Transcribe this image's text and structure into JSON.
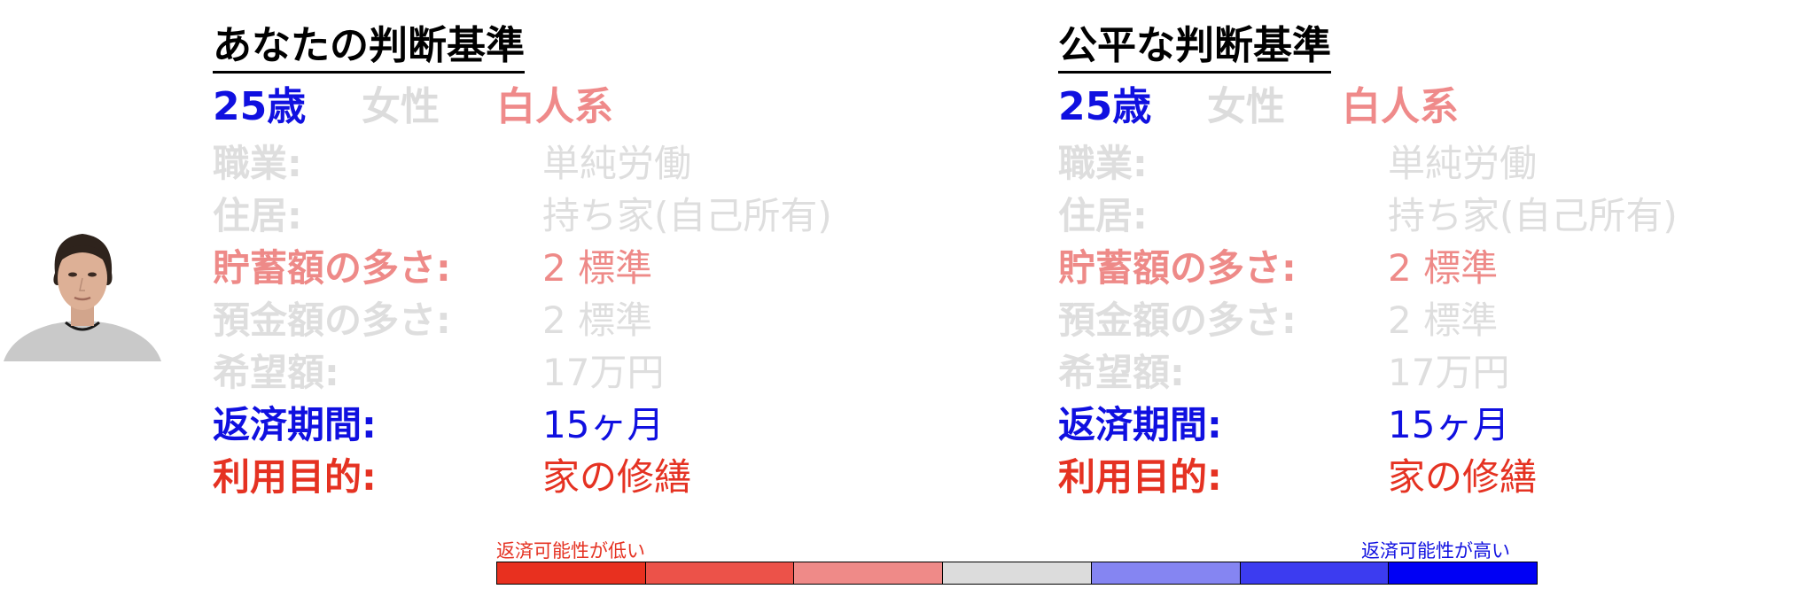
{
  "left_panel": {
    "title": "あなたの判断基準",
    "age": "25歳",
    "gender": "女性",
    "race": "白人系",
    "rows": [
      {
        "label": "職業:",
        "value": "単純労働"
      },
      {
        "label": "住居:",
        "value": "持ち家(自己所有)"
      },
      {
        "label": "貯蓄額の多さ:",
        "value": "2 標準"
      },
      {
        "label": "預金額の多さ:",
        "value": "2 標準"
      },
      {
        "label": "希望額:",
        "value": "17万円"
      },
      {
        "label": "返済期間:",
        "value": "15ヶ月"
      },
      {
        "label": "利用目的:",
        "value": "家の修繕"
      }
    ]
  },
  "right_panel": {
    "title": "公平な判断基準",
    "age": "25歳",
    "gender": "女性",
    "race": "白人系",
    "rows": [
      {
        "label": "職業:",
        "value": "単純労働"
      },
      {
        "label": "住居:",
        "value": "持ち家(自己所有)"
      },
      {
        "label": "貯蓄額の多さ:",
        "value": "2 標準"
      },
      {
        "label": "預金額の多さ:",
        "value": "2 標準"
      },
      {
        "label": "希望額:",
        "value": "17万円"
      },
      {
        "label": "返済期間:",
        "value": "15ヶ月"
      },
      {
        "label": "利用目的:",
        "value": "家の修繕"
      }
    ]
  },
  "scale": {
    "low_label": "返済可能性が低い",
    "high_label": "返済可能性が高い",
    "colors": [
      "#e8301f",
      "#ec5249",
      "#ef8a88",
      "#dcdcdc",
      "#8585f2",
      "#3c3cf0",
      "#0000f5"
    ]
  }
}
